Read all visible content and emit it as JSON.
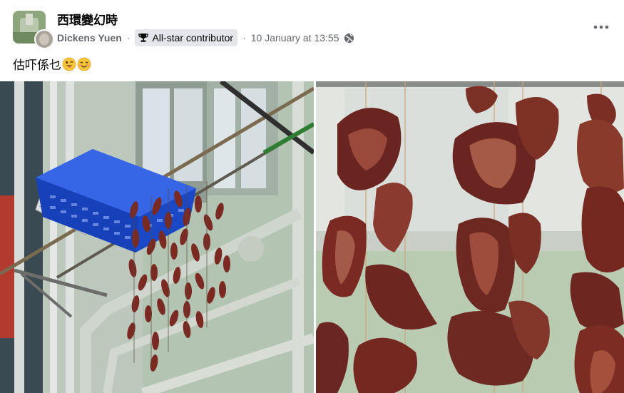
{
  "post": {
    "group_name": "西環變幻時",
    "author": "Dickens Yuen",
    "separator": "·",
    "badge_label": "All-star contributor",
    "timestamp": "10 January at 13:55",
    "privacy_icon": "globe-icon",
    "text": "估吓係乜",
    "emojis": [
      "winking-face-with-tongue",
      "smiling-face-with-smiling-eyes"
    ]
  },
  "icons": {
    "badge": "trophy-icon",
    "more": "more-options-icon"
  },
  "photos": [
    {
      "name": "photo-left",
      "subject": "dried sausages hanging under a blue crate on a building wall"
    },
    {
      "name": "photo-right",
      "subject": "close-up of cured duck wings hanging on strings"
    }
  ],
  "colors": {
    "text_primary": "#050505",
    "text_secondary": "#65676b",
    "badge_bg": "#e4e6eb",
    "crate_blue": "#1a4fd6",
    "meat_dark": "#7a2a22"
  }
}
